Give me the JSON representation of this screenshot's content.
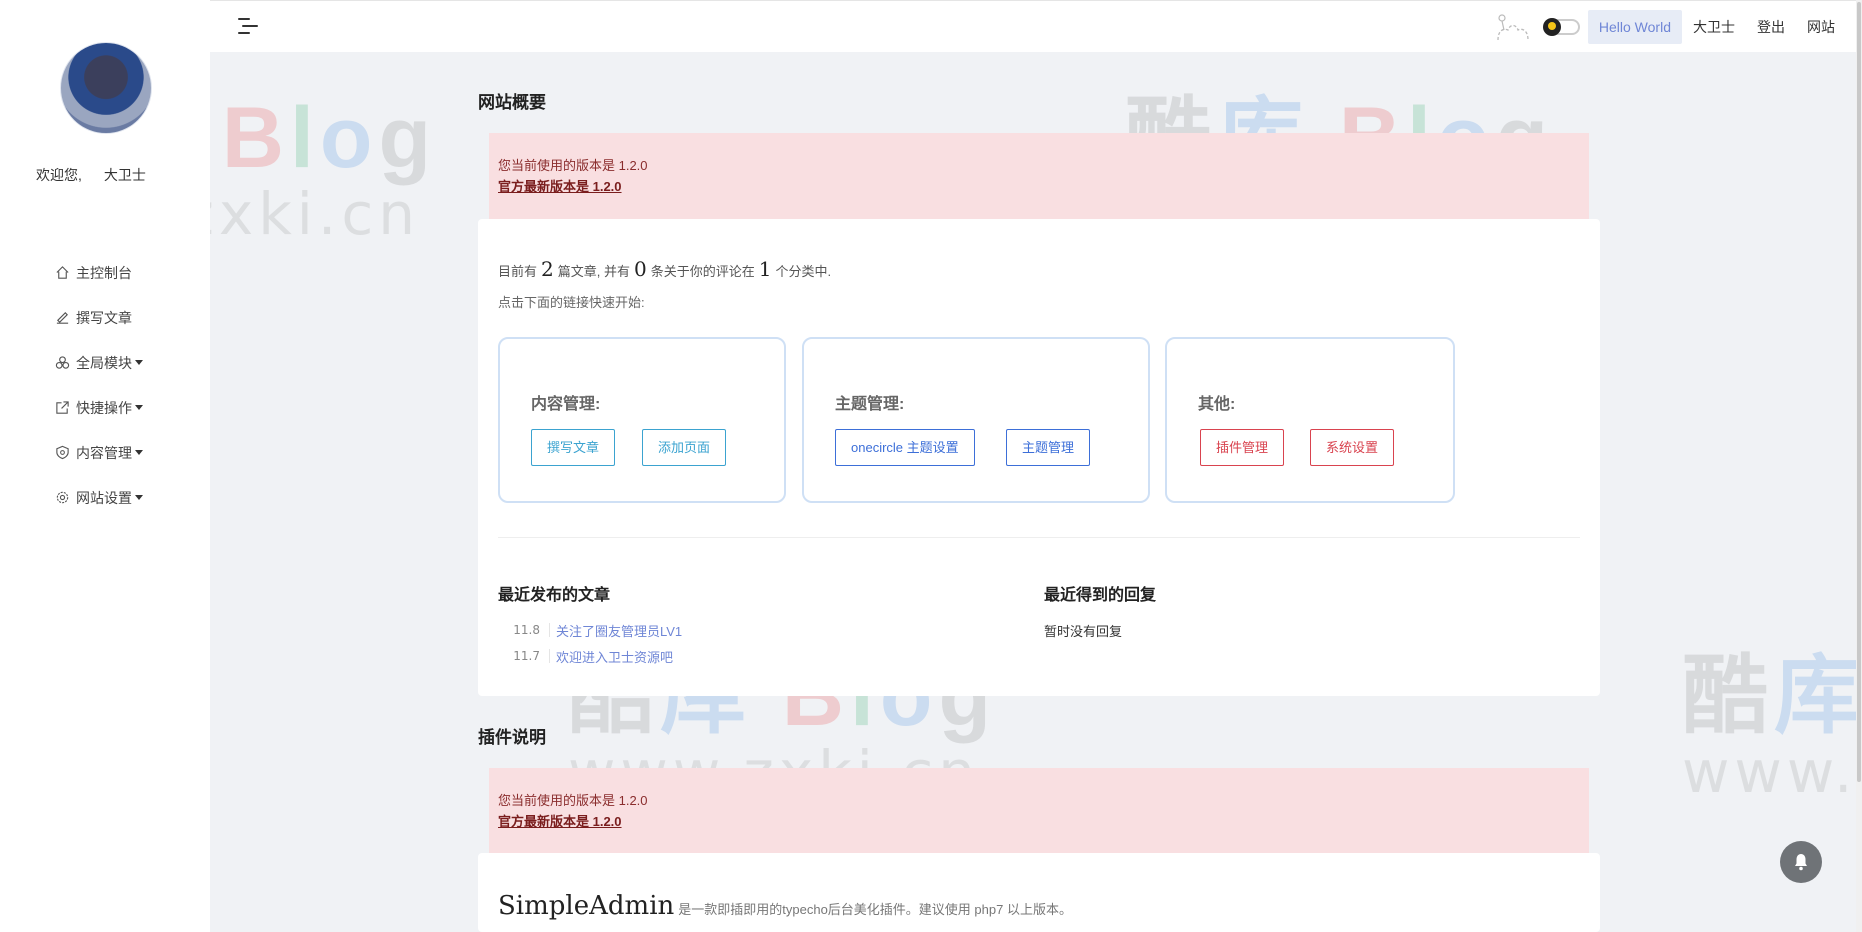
{
  "sidebar": {
    "welcome": "欢迎您,",
    "username": "大卫士",
    "items": [
      {
        "label": "主控制台",
        "icon": "home-icon"
      },
      {
        "label": "撰写文章",
        "icon": "edit-icon"
      },
      {
        "label": "全局模块",
        "icon": "modules-icon"
      },
      {
        "label": "快捷操作",
        "icon": "external-edit-icon"
      },
      {
        "label": "内容管理",
        "icon": "shield-icon"
      },
      {
        "label": "网站设置",
        "icon": "gear-icon"
      }
    ]
  },
  "topbar": {
    "active_label": "Hello World",
    "user_label": "大卫士",
    "logout_label": "登出",
    "site_label": "网站"
  },
  "overview": {
    "title": "网站概要",
    "notice_line1": "您当前使用的版本是 1.2.0",
    "notice_line2": "官方最新版本是 1.2.0",
    "stats_prefix": "目前有",
    "post_count": "2",
    "stats_mid1": "篇文章, 并有",
    "comment_count": "0",
    "stats_mid2": "条关于你的评论在",
    "category_count": "1",
    "stats_suffix": "个分类中.",
    "hint": "点击下面的链接快速开始:",
    "quick_groups": [
      {
        "title": "内容管理:",
        "buttons": [
          "撰写文章",
          "添加页面"
        ]
      },
      {
        "title": "主题管理:",
        "buttons": [
          "onecircle 主题设置",
          "主题管理"
        ]
      },
      {
        "title": "其他:",
        "buttons": [
          "插件管理",
          "系统设置"
        ]
      }
    ],
    "recent_posts_title": "最近发布的文章",
    "recent_posts": [
      {
        "date": "11.8",
        "title": "关注了圈友管理员LV1"
      },
      {
        "date": "11.7",
        "title": "欢迎进入卫士资源吧"
      }
    ],
    "recent_replies_title": "最近得到的回复",
    "no_reply": "暂时没有回复"
  },
  "plugin": {
    "title": "插件说明",
    "notice_line1": "您当前使用的版本是 1.2.0",
    "notice_line2": "官方最新版本是 1.2.0",
    "name": "SimpleAdmin",
    "desc": "是一款即插即用的typecho后台美化插件。建议使用 php7 以上版本。"
  },
  "watermark": {
    "c1": "酷",
    "c2": "库",
    "b": "B",
    "l": "l",
    "o": "o",
    "g": "g",
    "url": "www.zxki.cn"
  },
  "colors": {
    "accent": "#6f86d6",
    "notice_bg": "#f9dfe1",
    "info": "#3ba3d0",
    "primary": "#3d6fd8",
    "danger": "#d9434f"
  }
}
